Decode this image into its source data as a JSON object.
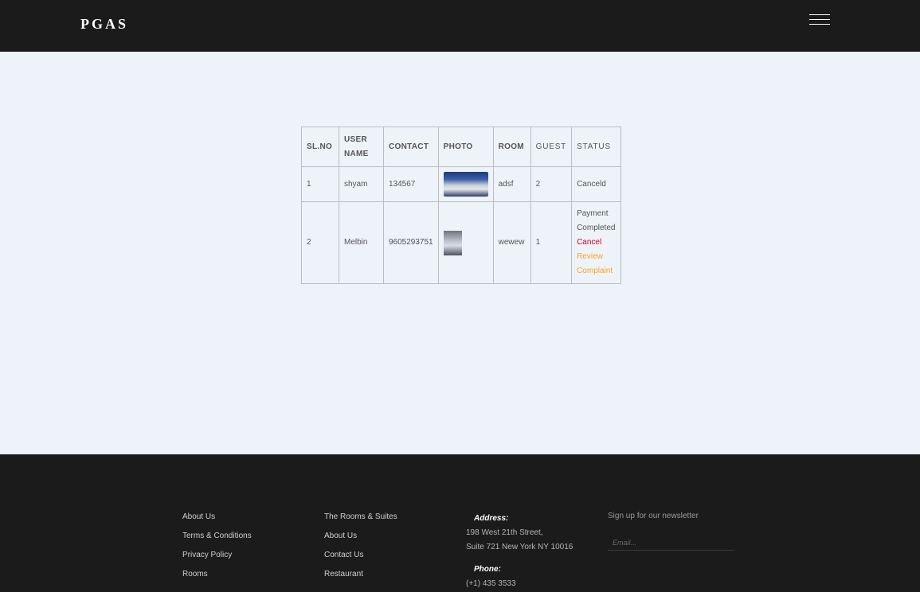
{
  "header": {
    "brand": "PGAS",
    "menu_icon": "hamburger-menu-icon"
  },
  "table": {
    "headers": [
      "SL.NO",
      "USER NAME",
      "CONTACT",
      "PHOTO",
      "ROOM",
      "GUEST",
      "STATUS"
    ],
    "rows": [
      {
        "sl": "1",
        "user": "shyam",
        "contact": "134567",
        "photo": "group-photo",
        "room": "adsf",
        "guest": "2",
        "status": "Canceld"
      },
      {
        "sl": "2",
        "user": "Melbin",
        "contact": "9605293751",
        "photo": "person-photo",
        "room": "wewew",
        "guest": "1",
        "status": "Payment Completed",
        "actions": {
          "cancel": "Cancel",
          "review": "Review",
          "complaint": "Complaint"
        }
      }
    ]
  },
  "footer": {
    "col1": [
      "About Us",
      "Terms & Conditions",
      "Privacy Policy",
      "Rooms"
    ],
    "col2": [
      "The Rooms & Suites",
      "About Us",
      "Contact Us",
      "Restaurant"
    ],
    "address_label": "Address:",
    "address_line1": "198 West 21th Street,",
    "address_line2": "Suite 721 New York NY 10016",
    "phone_label": "Phone:",
    "phone": "(+1) 435 3533",
    "newsletter_title": "Sign up for our newsletter",
    "email_placeholder": "Email..."
  },
  "colors": {
    "header_bg": "#1b1b1b",
    "page_bg": "#eef2f9",
    "cancel_link": "#d0021b",
    "review_link": "#f5a623"
  }
}
